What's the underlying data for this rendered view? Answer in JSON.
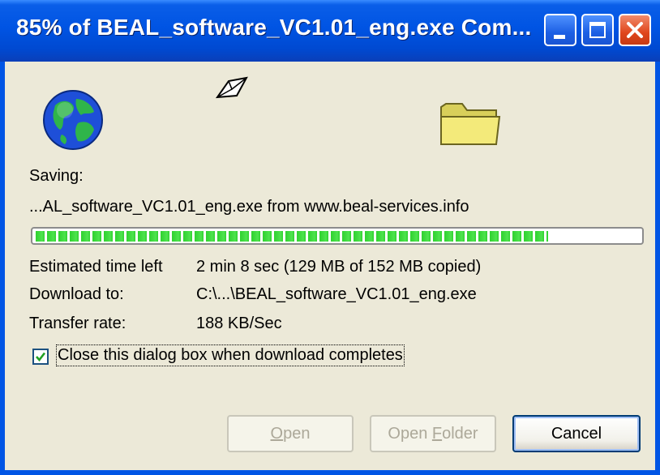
{
  "window": {
    "title": "85% of BEAL_software_VC1.01_eng.exe Com...",
    "controls": {
      "minimize": "minimize-icon",
      "maximize": "maximize-icon",
      "close": "close-icon"
    }
  },
  "status": {
    "saving_label": "Saving:",
    "file_line": "...AL_software_VC1.01_eng.exe from www.beal-services.info",
    "progress_fraction": 0.85
  },
  "details": {
    "time_left_label": "Estimated time left",
    "time_left_value": "2 min 8 sec (129 MB of 152 MB copied)",
    "download_to_label": "Download to:",
    "download_to_value": "C:\\...\\BEAL_software_VC1.01_eng.exe",
    "transfer_rate_label": "Transfer rate:",
    "transfer_rate_value": "188 KB/Sec"
  },
  "options": {
    "close_when_done_label": "Close this dialog box when download completes",
    "close_when_done_checked": true
  },
  "buttons": {
    "open_prefix": "",
    "open_mnemonic": "O",
    "open_rest": "pen",
    "open_folder_prefix": "Open ",
    "open_folder_mnemonic": "F",
    "open_folder_rest": "older",
    "cancel_label": "Cancel"
  },
  "colors": {
    "titlebar": "#0054e3",
    "dialog_bg": "#ece9d8",
    "progress": "#2fd12f"
  }
}
